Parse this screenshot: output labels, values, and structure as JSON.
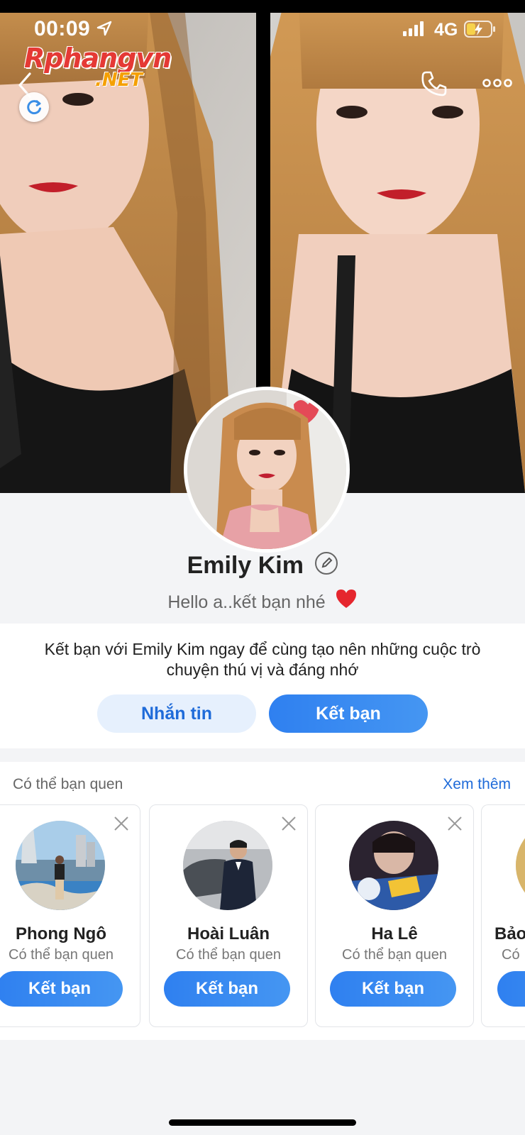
{
  "status_bar": {
    "time": "00:09",
    "network": "4G",
    "icons": [
      "location-arrow-icon",
      "signal-bars-icon",
      "battery-charging-icon"
    ]
  },
  "watermark": {
    "main": "Rphangvn",
    "sub": ".NET"
  },
  "top_bar": {
    "icons": [
      "back-chevron-icon",
      "refresh-icon",
      "phone-icon",
      "more-dots-icon"
    ]
  },
  "profile": {
    "name": "Emily Kim",
    "bio": "Hello a..kết bạn nhé"
  },
  "invite": {
    "text": "Kết bạn với Emily Kim ngay để cùng tạo nên những cuộc trò chuyện thú vị và đáng nhớ",
    "message_label": "Nhắn tin",
    "add_friend_label": "Kết bạn"
  },
  "suggestions": {
    "title": "Có thể bạn quen",
    "see_more": "Xem thêm",
    "cards": [
      {
        "name": "Phong Ngô",
        "subtitle": "Có thể bạn quen",
        "button": "Kết bạn"
      },
      {
        "name": "Hoài Luân",
        "subtitle": "Có thể bạn quen",
        "button": "Kết bạn"
      },
      {
        "name": "Ha Lê",
        "subtitle": "Có thể bạn quen",
        "button": "Kết bạn"
      },
      {
        "name": "Bảo",
        "subtitle": "Có",
        "button": ""
      }
    ]
  },
  "colors": {
    "accent": "#2f80f0",
    "accent_light_bg": "#e6f0fd",
    "page_bg": "#f3f4f6"
  }
}
